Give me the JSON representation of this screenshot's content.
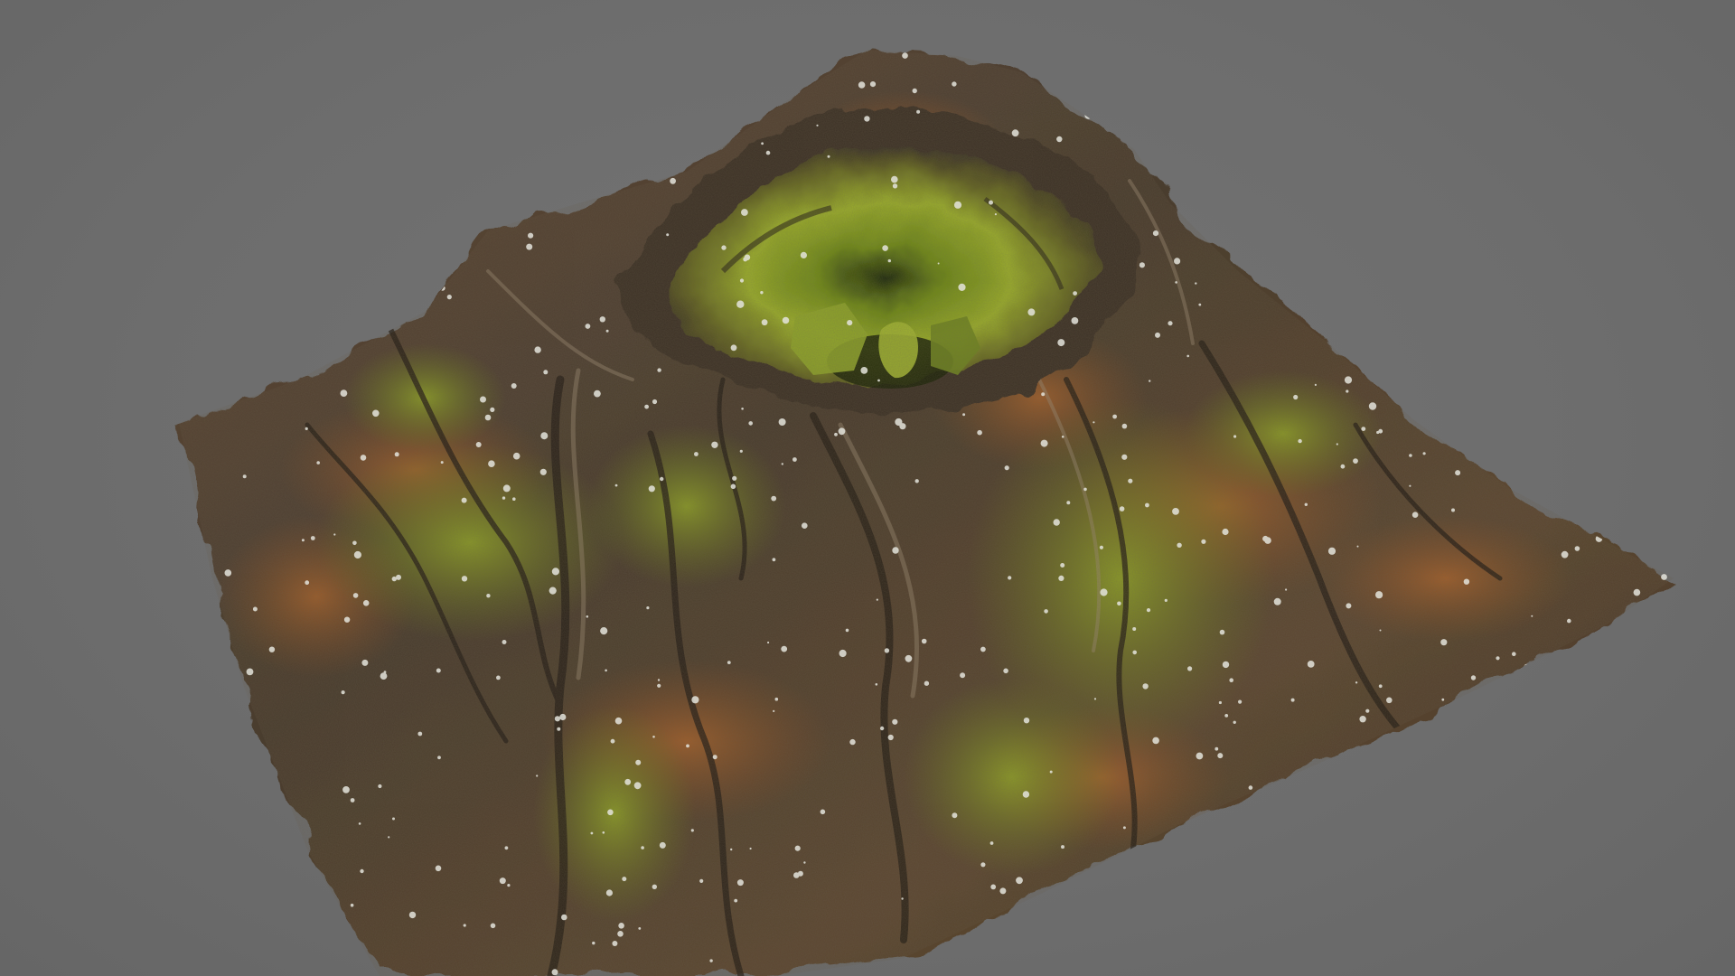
{
  "scene": {
    "subject": "volcano-terrain-model",
    "colors": {
      "background": "#6e6e6e",
      "rock_dark": "#3a332b",
      "rock_mid": "#6b5238",
      "rust": "#b0642a",
      "moss": "#7d8f1f",
      "moss_bright": "#a9b52c",
      "speckle": "#e6e6e0"
    }
  }
}
